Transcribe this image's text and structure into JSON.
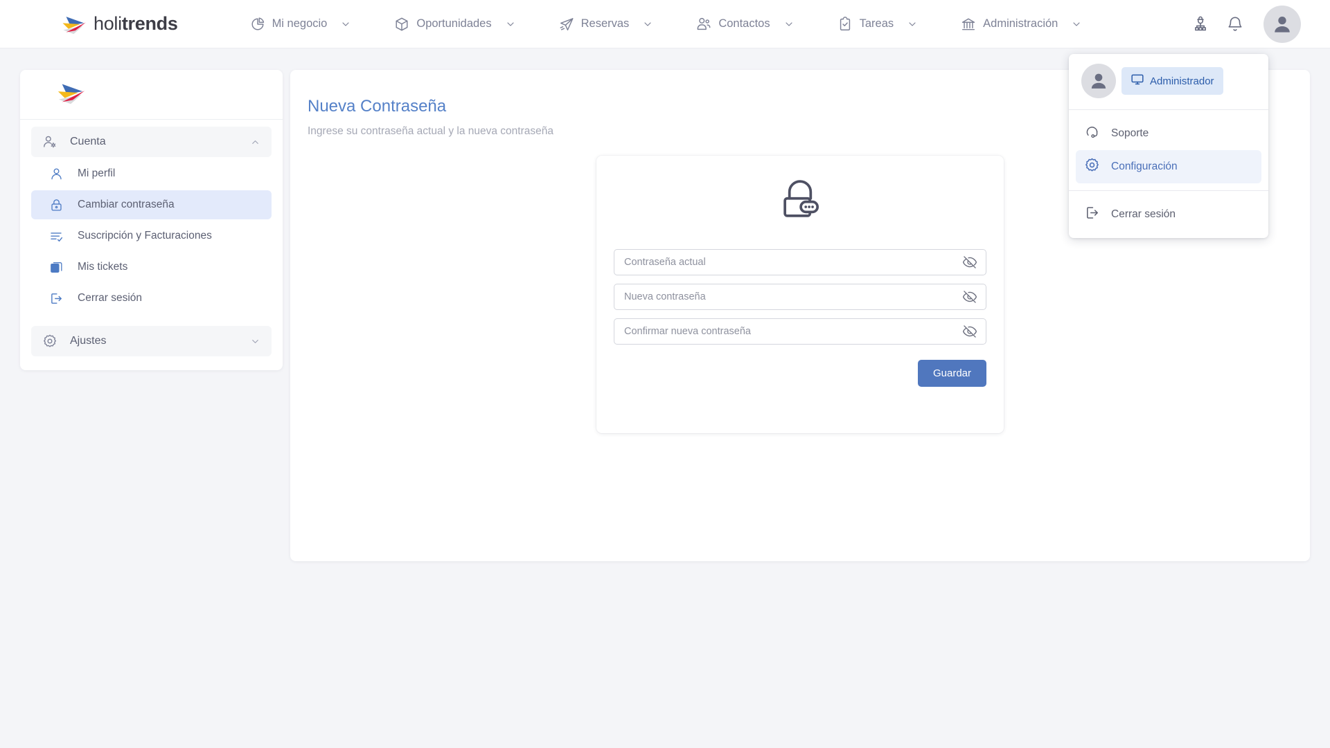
{
  "brand": {
    "name_thin": "holi",
    "name_bold": "trends",
    "logo_icon": "holitrends-bird-logo"
  },
  "topnav": {
    "items": [
      {
        "label": "Mi negocio",
        "icon": "pie-chart-icon",
        "chevron": "chevron-down-icon"
      },
      {
        "label": "Oportunidades",
        "icon": "box-3d-icon",
        "chevron": "chevron-down-icon"
      },
      {
        "label": "Reservas",
        "icon": "paper-plane-icon",
        "chevron": "chevron-down-icon"
      },
      {
        "label": "Contactos",
        "icon": "users-icon",
        "chevron": "chevron-down-icon"
      },
      {
        "label": "Tareas",
        "icon": "clipboard-check-icon",
        "chevron": "chevron-down-icon"
      },
      {
        "label": "Administración",
        "icon": "bank-icon",
        "chevron": "chevron-down-icon"
      }
    ],
    "right_icons": [
      {
        "name": "agent-supervisor-icon"
      },
      {
        "name": "bell-notification-icon"
      },
      {
        "name": "user-avatar-icon"
      }
    ]
  },
  "dropdown": {
    "role_badge": {
      "label": "Administrador",
      "icon": "monitor-screen-icon"
    },
    "avatar_icon": "user-avatar-icon",
    "items": [
      {
        "label": "Soporte",
        "icon": "headset-support-icon",
        "active": false
      },
      {
        "label": "Configuración",
        "icon": "gear-icon",
        "active": true
      },
      {
        "label": "Cerrar sesión",
        "icon": "logout-icon",
        "active": false
      }
    ]
  },
  "sidebar": {
    "logo_icon": "holitrends-bird-logo",
    "groups": [
      {
        "label": "Cuenta",
        "icon": "user-gear-icon",
        "chevron": "chevron-up-icon",
        "expanded": true
      },
      {
        "label": "Ajustes",
        "icon": "gear-icon",
        "chevron": "chevron-down-icon",
        "expanded": false
      }
    ],
    "items": [
      {
        "label": "Mi perfil",
        "icon": "user-icon",
        "active": false
      },
      {
        "label": "Cambiar contraseña",
        "icon": "lock-icon",
        "active": true
      },
      {
        "label": "Suscripción y Facturaciones",
        "icon": "list-check-icon",
        "active": false
      },
      {
        "label": "Mis tickets",
        "icon": "tickets-stack-icon",
        "active": false
      },
      {
        "label": "Cerrar sesión",
        "icon": "logout-icon",
        "active": false
      }
    ]
  },
  "main": {
    "title": "Nueva Contraseña",
    "subtitle": "Ingrese su contraseña actual y la nueva contraseña",
    "hero_icon": "padlock-password-icon",
    "fields": [
      {
        "name": "current-password",
        "placeholder": "Contraseña actual",
        "value": "",
        "toggle_icon": "eye-off-icon"
      },
      {
        "name": "new-password",
        "placeholder": "Nueva contraseña",
        "value": "",
        "toggle_icon": "eye-off-icon"
      },
      {
        "name": "confirm-password",
        "placeholder": "Confirmar nueva contraseña",
        "value": "",
        "toggle_icon": "eye-off-icon"
      }
    ],
    "save_label": "Guardar"
  },
  "colors": {
    "primary_button": "#5077be",
    "title_blue": "#5581c8",
    "sidebar_active_bg": "#e3eafb",
    "badge_bg": "#dde8f8",
    "badge_text": "#2b5caa",
    "page_bg": "#f4f5f8",
    "nav_text": "#7e8296"
  }
}
